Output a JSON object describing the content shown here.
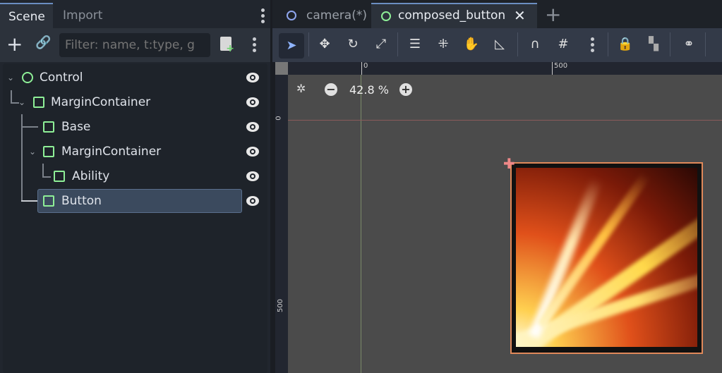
{
  "left_panel": {
    "tabs": [
      {
        "label": "Scene",
        "active": true
      },
      {
        "label": "Import",
        "active": false
      }
    ],
    "filter_placeholder": "Filter: name, t:type, g",
    "tree": [
      {
        "label": "Control",
        "type": "control",
        "depth": 0
      },
      {
        "label": "MarginContainer",
        "type": "container",
        "depth": 1
      },
      {
        "label": "Base",
        "type": "texture",
        "depth": 2
      },
      {
        "label": "MarginContainer",
        "type": "container",
        "depth": 2
      },
      {
        "label": "Ability",
        "type": "texture",
        "depth": 3
      },
      {
        "label": "Button",
        "type": "button",
        "depth": 2,
        "selected": true
      }
    ]
  },
  "editor": {
    "tabs": [
      {
        "label": "camera(*)",
        "active": false
      },
      {
        "label": "composed_button",
        "active": true
      }
    ],
    "zoom": "42.8 %",
    "ruler_h": [
      "0",
      "500"
    ],
    "ruler_v": [
      "0",
      "500"
    ]
  },
  "colors": {
    "accent": "#6b8ec2",
    "node_green": "#8eef97",
    "selection_border": "#e0895a"
  }
}
